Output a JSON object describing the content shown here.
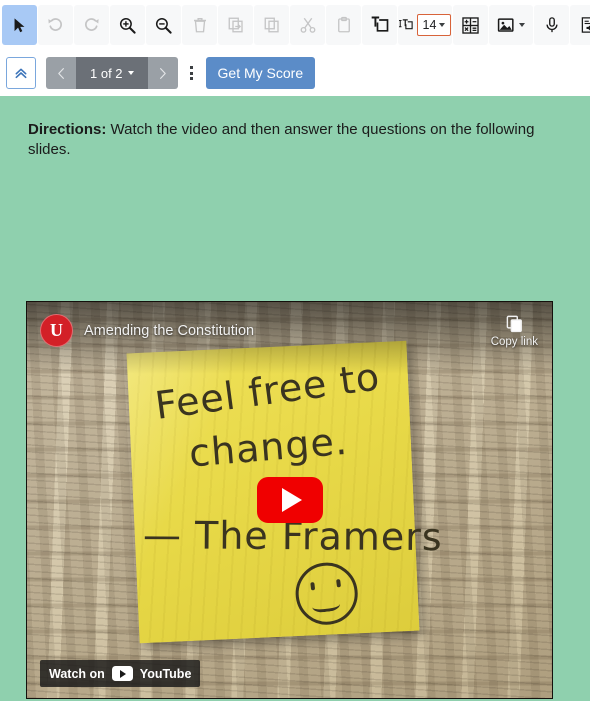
{
  "toolbar": {
    "tools": [
      {
        "name": "select-pointer-tool",
        "icon": "cursor-arrow-icon",
        "state": "active",
        "enabled": true
      },
      {
        "name": "undo-tool",
        "icon": "undo-icon",
        "state": "disabled",
        "enabled": false
      },
      {
        "name": "redo-tool",
        "icon": "redo-icon",
        "state": "disabled",
        "enabled": false
      },
      {
        "name": "zoom-in-tool",
        "icon": "zoom-in-icon",
        "state": "normal",
        "enabled": true
      },
      {
        "name": "zoom-out-tool",
        "icon": "zoom-out-icon",
        "state": "normal",
        "enabled": true
      },
      {
        "name": "delete-tool",
        "icon": "trash-icon",
        "state": "disabled",
        "enabled": false
      },
      {
        "name": "duplicate-tool",
        "icon": "duplicate-icon",
        "state": "disabled",
        "enabled": false
      },
      {
        "name": "copy-tool",
        "icon": "copy-icon",
        "state": "disabled",
        "enabled": false
      },
      {
        "name": "cut-tool",
        "icon": "scissors-icon",
        "state": "disabled",
        "enabled": false
      },
      {
        "name": "paste-tool",
        "icon": "clipboard-icon",
        "state": "disabled",
        "enabled": false
      },
      {
        "name": "text-box-tool",
        "icon": "text-box-icon",
        "state": "normal",
        "enabled": true
      },
      {
        "name": "font-size-tool",
        "icon": "text-height-icon",
        "state": "normal",
        "enabled": true
      },
      {
        "name": "equation-tool",
        "icon": "math-equation-icon",
        "state": "normal",
        "enabled": true
      },
      {
        "name": "insert-image-tool",
        "icon": "image-icon",
        "state": "normal",
        "enabled": true
      },
      {
        "name": "record-audio-tool",
        "icon": "microphone-icon",
        "state": "normal",
        "enabled": true
      },
      {
        "name": "audio-note-tool",
        "icon": "audio-file-icon",
        "state": "normal",
        "enabled": true
      },
      {
        "name": "insert-link-tool",
        "icon": "link-icon",
        "state": "normal",
        "enabled": true
      }
    ],
    "font_size": {
      "value": "14",
      "icon": "text-height-icon"
    }
  },
  "navbar": {
    "collapse_icon": "double-chevron-up-icon",
    "prev_icon": "chevron-left-icon",
    "next_icon": "chevron-right-icon",
    "page_indicator": "1 of 2",
    "current_page": 1,
    "total_pages": 2,
    "menu_icon": "kebab-menu-icon",
    "score_button_label": "Get My Score",
    "score_button_color": "#5b8cc8"
  },
  "content": {
    "background_color": "#8fd0ae",
    "directions_label": "Directions:",
    "directions_text": " Watch the video and then answer the questions on the following slides."
  },
  "video": {
    "channel_avatar_letter": "U",
    "channel_avatar_color": "#d32027",
    "title": "Amending the Constitution",
    "copy_link_label": "Copy link",
    "copy_link_icon": "copy-icon",
    "play_button_icon": "youtube-play-icon",
    "play_button_color": "#f00000",
    "watch_label": "Watch on",
    "youtube_label": "YouTube",
    "thumbnail": {
      "note_line1": "Feel free to",
      "note_line2": "change.",
      "note_line3": "— The Framers",
      "note_emoji": "smiley-face",
      "note_color": "#e8d948",
      "background": "constitution-parchment-handwriting"
    }
  }
}
